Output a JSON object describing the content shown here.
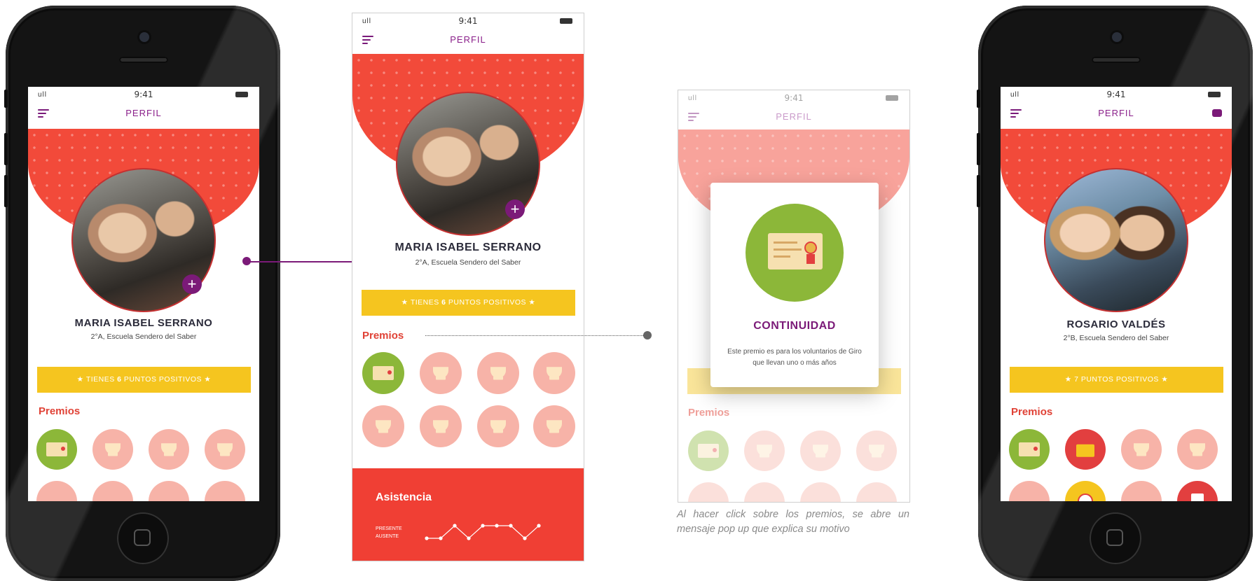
{
  "status": {
    "time": "9:41",
    "signal": "ull"
  },
  "screen_title": "PERFIL",
  "profile1": {
    "name": "MARIA ISABEL SERRANO",
    "school_a": "2°A, Escuela Sendero del Saber",
    "school_b": "2°A, Escuela Sendero del Saber",
    "points_prefix": "★ TIENES ",
    "points_value": "6",
    "points_suffix": " PUNTOS POSITIVOS ★",
    "plus_label": "+"
  },
  "profile2": {
    "name": "ROSARIO VALDÉS",
    "school": "2°B, Escuela Sendero del Saber",
    "points": "★  7 PUNTOS POSITIVOS  ★"
  },
  "section": {
    "premios": "Premios",
    "asistencia": "Asistencia"
  },
  "attendance": {
    "present_label": "PRESENTE",
    "absent_label": "AUSENTE",
    "pattern": [
      0,
      0,
      1,
      0,
      1,
      1,
      1,
      0,
      1
    ]
  },
  "popup": {
    "title": "CONTINUIDAD",
    "body": "Este premio es para los voluntarios de Giro que llevan uno o más años"
  },
  "caption": "Al hacer click sobre los premios, se abre un mensaje pop up que explica su motivo",
  "colors": {
    "brand_purple": "#7b1a78",
    "accent_red": "#f24a3a",
    "accent_yellow": "#f5c51f",
    "award_green": "#8cb739"
  },
  "icons": {
    "menu": "menu-icon",
    "chat": "chat-icon",
    "award": "certificate-icon",
    "trophy": "trophy-icon"
  }
}
